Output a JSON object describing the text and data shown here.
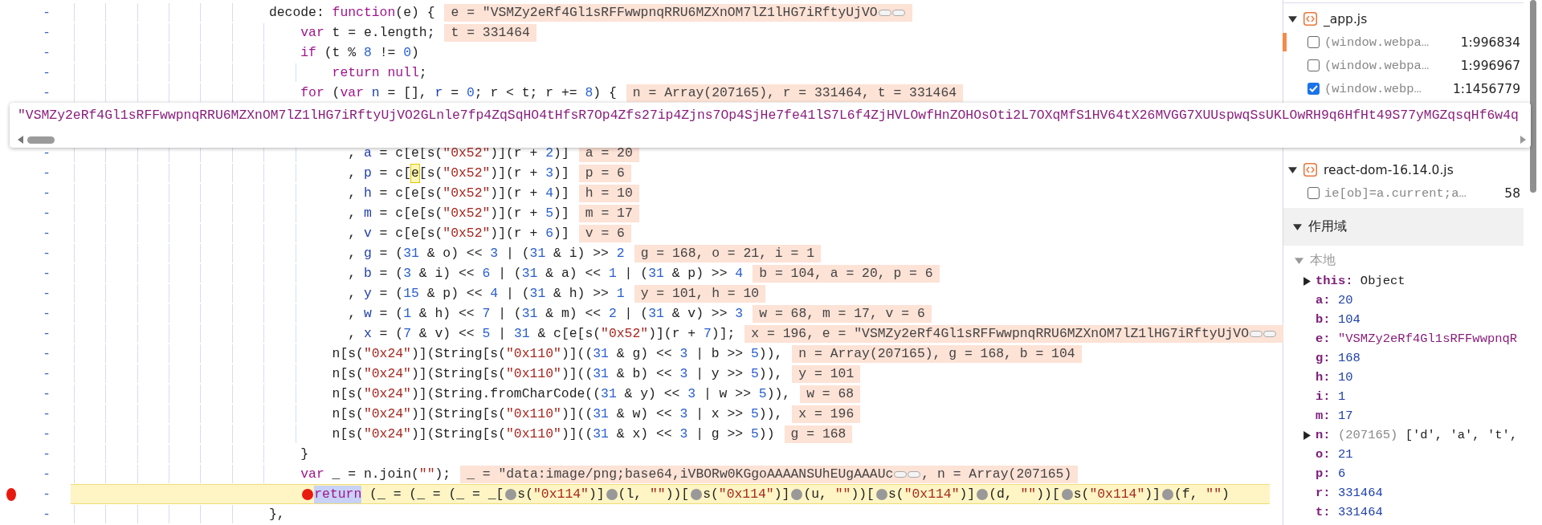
{
  "code_lines": [
    {
      "kind": "code",
      "number": "-",
      "breakpoint": false,
      "paused": false,
      "tokens": [
        {
          "kind": "txt",
          "text": "                         decode: "
        },
        {
          "kind": "kw",
          "text": "function"
        },
        {
          "kind": "txt",
          "text": "(e) {"
        }
      ],
      "value": "e = \"VSMZy2eRf4Gl1sRFFwwpnqRRU6MZXnOM7lZ1lHG7iRftyUjVO",
      "truncated": true
    },
    {
      "kind": "code",
      "number": "-",
      "breakpoint": false,
      "paused": false,
      "tokens": [
        {
          "kind": "kw",
          "text": "                             var"
        },
        {
          "kind": "txt",
          "text": " t = e.length;"
        }
      ],
      "value": "t = 331464",
      "truncated": false
    },
    {
      "kind": "code",
      "number": "-",
      "breakpoint": false,
      "paused": false,
      "tokens": [
        {
          "kind": "kw",
          "text": "                             if"
        },
        {
          "kind": "txt",
          "text": " (t % "
        },
        {
          "kind": "num",
          "text": "8"
        },
        {
          "kind": "txt",
          "text": " != "
        },
        {
          "kind": "num",
          "text": "0"
        },
        {
          "kind": "txt",
          "text": ")"
        }
      ]
    },
    {
      "kind": "code",
      "number": "-",
      "breakpoint": false,
      "paused": false,
      "tokens": [
        {
          "kind": "kw",
          "text": "                                 return null"
        },
        {
          "kind": "txt",
          "text": ";"
        }
      ]
    },
    {
      "kind": "code",
      "number": "-",
      "breakpoint": false,
      "paused": false,
      "tokens": [
        {
          "kind": "kw",
          "text": "                             for"
        },
        {
          "kind": "txt",
          "text": " ("
        },
        {
          "kind": "kw",
          "text": "var"
        },
        {
          "kind": "def",
          "text": " n"
        },
        {
          "kind": "txt",
          "text": " = [], "
        },
        {
          "kind": "def",
          "text": "r"
        },
        {
          "kind": "txt",
          "text": " = "
        },
        {
          "kind": "num",
          "text": "0"
        },
        {
          "kind": "txt",
          "text": "; r < t; r += "
        },
        {
          "kind": "num",
          "text": "8"
        },
        {
          "kind": "txt",
          "text": ") {"
        }
      ],
      "value": "n = Array(207165), r = 331464, t = 331464",
      "truncated": false
    },
    {
      "kind": "popup",
      "text": "\"VSMZy2eRf4Gl1sRFFwwpnqRRU6MZXnOM7lZ1lHG7iRftyUjVO2GLnle7fp4ZqSqHO4tHfsR7Op4Zfs27ip4Zjns7Op4SjHe7fe41lS7L6f4ZjHVLOwfHnZOHOsOti2L7OXqMfS1HV64tX26MVGG7XUUspwqSsUKLOwRH9q6HfHt49S77yMGZqsqHf6w4q"
    },
    {
      "kind": "code",
      "number": "-",
      "breakpoint": false,
      "paused": false,
      "tokens": [
        {
          "kind": "txt",
          "text": "                                   , "
        },
        {
          "kind": "def",
          "text": "a"
        },
        {
          "kind": "txt",
          "text": " = c[e[s("
        },
        {
          "kind": "str",
          "text": "\"0x52\""
        },
        {
          "kind": "txt",
          "text": ")](r + "
        },
        {
          "kind": "num",
          "text": "2"
        },
        {
          "kind": "txt",
          "text": ")]"
        }
      ],
      "value": "a = 20",
      "truncated": false
    },
    {
      "kind": "code",
      "number": "-",
      "breakpoint": false,
      "paused": false,
      "tokens": [
        {
          "kind": "txt",
          "text": "                                   , "
        },
        {
          "kind": "def",
          "text": "p"
        },
        {
          "kind": "txt",
          "text": " = c["
        },
        {
          "kind": "hover",
          "text": "e"
        },
        {
          "kind": "txt",
          "text": "[s("
        },
        {
          "kind": "str",
          "text": "\"0x52\""
        },
        {
          "kind": "txt",
          "text": ")](r + "
        },
        {
          "kind": "num",
          "text": "3"
        },
        {
          "kind": "txt",
          "text": ")]"
        }
      ],
      "value": "p = 6",
      "truncated": false
    },
    {
      "kind": "code",
      "number": "-",
      "breakpoint": false,
      "paused": false,
      "tokens": [
        {
          "kind": "txt",
          "text": "                                   , "
        },
        {
          "kind": "def",
          "text": "h"
        },
        {
          "kind": "txt",
          "text": " = c[e[s("
        },
        {
          "kind": "str",
          "text": "\"0x52\""
        },
        {
          "kind": "txt",
          "text": ")](r + "
        },
        {
          "kind": "num",
          "text": "4"
        },
        {
          "kind": "txt",
          "text": ")]"
        }
      ],
      "value": "h = 10",
      "truncated": false
    },
    {
      "kind": "code",
      "number": "-",
      "breakpoint": false,
      "paused": false,
      "tokens": [
        {
          "kind": "txt",
          "text": "                                   , "
        },
        {
          "kind": "def",
          "text": "m"
        },
        {
          "kind": "txt",
          "text": " = c[e[s("
        },
        {
          "kind": "str",
          "text": "\"0x52\""
        },
        {
          "kind": "txt",
          "text": ")](r + "
        },
        {
          "kind": "num",
          "text": "5"
        },
        {
          "kind": "txt",
          "text": ")]"
        }
      ],
      "value": "m = 17",
      "truncated": false
    },
    {
      "kind": "code",
      "number": "-",
      "breakpoint": false,
      "paused": false,
      "tokens": [
        {
          "kind": "txt",
          "text": "                                   , "
        },
        {
          "kind": "def",
          "text": "v"
        },
        {
          "kind": "txt",
          "text": " = c[e[s("
        },
        {
          "kind": "str",
          "text": "\"0x52\""
        },
        {
          "kind": "txt",
          "text": ")](r + "
        },
        {
          "kind": "num",
          "text": "6"
        },
        {
          "kind": "txt",
          "text": ")]"
        }
      ],
      "value": "v = 6",
      "truncated": false
    },
    {
      "kind": "code",
      "number": "-",
      "breakpoint": false,
      "paused": false,
      "tokens": [
        {
          "kind": "txt",
          "text": "                                   , "
        },
        {
          "kind": "def",
          "text": "g"
        },
        {
          "kind": "txt",
          "text": " = ("
        },
        {
          "kind": "num",
          "text": "31"
        },
        {
          "kind": "txt",
          "text": " & o) << "
        },
        {
          "kind": "num",
          "text": "3"
        },
        {
          "kind": "txt",
          "text": " | ("
        },
        {
          "kind": "num",
          "text": "31"
        },
        {
          "kind": "txt",
          "text": " & i) >> "
        },
        {
          "kind": "num",
          "text": "2"
        }
      ],
      "value": "g = 168, o = 21, i = 1",
      "truncated": false
    },
    {
      "kind": "code",
      "number": "-",
      "breakpoint": false,
      "paused": false,
      "tokens": [
        {
          "kind": "txt",
          "text": "                                   , "
        },
        {
          "kind": "def",
          "text": "b"
        },
        {
          "kind": "txt",
          "text": " = ("
        },
        {
          "kind": "num",
          "text": "3"
        },
        {
          "kind": "txt",
          "text": " & i) << "
        },
        {
          "kind": "num",
          "text": "6"
        },
        {
          "kind": "txt",
          "text": " | ("
        },
        {
          "kind": "num",
          "text": "31"
        },
        {
          "kind": "txt",
          "text": " & a) << "
        },
        {
          "kind": "num",
          "text": "1"
        },
        {
          "kind": "txt",
          "text": " | ("
        },
        {
          "kind": "num",
          "text": "31"
        },
        {
          "kind": "txt",
          "text": " & p) >> "
        },
        {
          "kind": "num",
          "text": "4"
        }
      ],
      "value": "b = 104, a = 20, p = 6",
      "truncated": false
    },
    {
      "kind": "code",
      "number": "-",
      "breakpoint": false,
      "paused": false,
      "tokens": [
        {
          "kind": "txt",
          "text": "                                   , "
        },
        {
          "kind": "def",
          "text": "y"
        },
        {
          "kind": "txt",
          "text": " = ("
        },
        {
          "kind": "num",
          "text": "15"
        },
        {
          "kind": "txt",
          "text": " & p) << "
        },
        {
          "kind": "num",
          "text": "4"
        },
        {
          "kind": "txt",
          "text": " | ("
        },
        {
          "kind": "num",
          "text": "31"
        },
        {
          "kind": "txt",
          "text": " & h) >> "
        },
        {
          "kind": "num",
          "text": "1"
        }
      ],
      "value": "y = 101, h = 10",
      "truncated": false
    },
    {
      "kind": "code",
      "number": "-",
      "breakpoint": false,
      "paused": false,
      "tokens": [
        {
          "kind": "txt",
          "text": "                                   , "
        },
        {
          "kind": "def",
          "text": "w"
        },
        {
          "kind": "txt",
          "text": " = ("
        },
        {
          "kind": "num",
          "text": "1"
        },
        {
          "kind": "txt",
          "text": " & h) << "
        },
        {
          "kind": "num",
          "text": "7"
        },
        {
          "kind": "txt",
          "text": " | ("
        },
        {
          "kind": "num",
          "text": "31"
        },
        {
          "kind": "txt",
          "text": " & m) << "
        },
        {
          "kind": "num",
          "text": "2"
        },
        {
          "kind": "txt",
          "text": " | ("
        },
        {
          "kind": "num",
          "text": "31"
        },
        {
          "kind": "txt",
          "text": " & v) >> "
        },
        {
          "kind": "num",
          "text": "3"
        }
      ],
      "value": "w = 68, m = 17, v = 6",
      "truncated": false
    },
    {
      "kind": "code",
      "number": "-",
      "breakpoint": false,
      "paused": false,
      "tokens": [
        {
          "kind": "txt",
          "text": "                                   , "
        },
        {
          "kind": "def",
          "text": "x"
        },
        {
          "kind": "txt",
          "text": " = ("
        },
        {
          "kind": "num",
          "text": "7"
        },
        {
          "kind": "txt",
          "text": " & v) << "
        },
        {
          "kind": "num",
          "text": "5"
        },
        {
          "kind": "txt",
          "text": " | "
        },
        {
          "kind": "num",
          "text": "31"
        },
        {
          "kind": "txt",
          "text": " & c[e[s("
        },
        {
          "kind": "str",
          "text": "\"0x52\""
        },
        {
          "kind": "txt",
          "text": ")](r + "
        },
        {
          "kind": "num",
          "text": "7"
        },
        {
          "kind": "txt",
          "text": ")];"
        }
      ],
      "value": "x = 196, e = \"VSMZy2eRf4Gl1sRFFwwpnqRRU6MZXnOM7lZ1lHG7iRftyUjVO",
      "truncated": true
    },
    {
      "kind": "code",
      "number": "-",
      "breakpoint": false,
      "paused": false,
      "tokens": [
        {
          "kind": "txt",
          "text": "                                 n[s("
        },
        {
          "kind": "str",
          "text": "\"0x24\""
        },
        {
          "kind": "txt",
          "text": ")](String[s("
        },
        {
          "kind": "str",
          "text": "\"0x110\""
        },
        {
          "kind": "txt",
          "text": ")](("
        },
        {
          "kind": "num",
          "text": "31"
        },
        {
          "kind": "txt",
          "text": " & g) << "
        },
        {
          "kind": "num",
          "text": "3"
        },
        {
          "kind": "txt",
          "text": " | b >> "
        },
        {
          "kind": "num",
          "text": "5"
        },
        {
          "kind": "txt",
          "text": ")),"
        }
      ],
      "value": "n = Array(207165), g = 168, b = 104",
      "truncated": false
    },
    {
      "kind": "code",
      "number": "-",
      "breakpoint": false,
      "paused": false,
      "tokens": [
        {
          "kind": "txt",
          "text": "                                 n[s("
        },
        {
          "kind": "str",
          "text": "\"0x24\""
        },
        {
          "kind": "txt",
          "text": ")](String[s("
        },
        {
          "kind": "str",
          "text": "\"0x110\""
        },
        {
          "kind": "txt",
          "text": ")](("
        },
        {
          "kind": "num",
          "text": "31"
        },
        {
          "kind": "txt",
          "text": " & b) << "
        },
        {
          "kind": "num",
          "text": "3"
        },
        {
          "kind": "txt",
          "text": " | y >> "
        },
        {
          "kind": "num",
          "text": "5"
        },
        {
          "kind": "txt",
          "text": ")),"
        }
      ],
      "value": "y = 101",
      "truncated": false
    },
    {
      "kind": "code",
      "number": "-",
      "breakpoint": false,
      "paused": false,
      "tokens": [
        {
          "kind": "txt",
          "text": "                                 n[s("
        },
        {
          "kind": "str",
          "text": "\"0x24\""
        },
        {
          "kind": "txt",
          "text": ")](String.fromCharCode(("
        },
        {
          "kind": "num",
          "text": "31"
        },
        {
          "kind": "txt",
          "text": " & y) << "
        },
        {
          "kind": "num",
          "text": "3"
        },
        {
          "kind": "txt",
          "text": " | w >> "
        },
        {
          "kind": "num",
          "text": "5"
        },
        {
          "kind": "txt",
          "text": ")),"
        }
      ],
      "value": "w = 68",
      "truncated": false
    },
    {
      "kind": "code",
      "number": "-",
      "breakpoint": false,
      "paused": false,
      "tokens": [
        {
          "kind": "txt",
          "text": "                                 n[s("
        },
        {
          "kind": "str",
          "text": "\"0x24\""
        },
        {
          "kind": "txt",
          "text": ")](String[s("
        },
        {
          "kind": "str",
          "text": "\"0x110\""
        },
        {
          "kind": "txt",
          "text": ")](("
        },
        {
          "kind": "num",
          "text": "31"
        },
        {
          "kind": "txt",
          "text": " & w) << "
        },
        {
          "kind": "num",
          "text": "3"
        },
        {
          "kind": "txt",
          "text": " | x >> "
        },
        {
          "kind": "num",
          "text": "5"
        },
        {
          "kind": "txt",
          "text": ")),"
        }
      ],
      "value": "x = 196",
      "truncated": false
    },
    {
      "kind": "code",
      "number": "-",
      "breakpoint": false,
      "paused": false,
      "tokens": [
        {
          "kind": "txt",
          "text": "                                 n[s("
        },
        {
          "kind": "str",
          "text": "\"0x24\""
        },
        {
          "kind": "txt",
          "text": ")](String[s("
        },
        {
          "kind": "str",
          "text": "\"0x110\""
        },
        {
          "kind": "txt",
          "text": ")](("
        },
        {
          "kind": "num",
          "text": "31"
        },
        {
          "kind": "txt",
          "text": " & x) << "
        },
        {
          "kind": "num",
          "text": "3"
        },
        {
          "kind": "txt",
          "text": " | g >> "
        },
        {
          "kind": "num",
          "text": "5"
        },
        {
          "kind": "txt",
          "text": "))"
        }
      ],
      "value": "g = 168",
      "truncated": false
    },
    {
      "kind": "code",
      "number": "-",
      "breakpoint": false,
      "paused": false,
      "tokens": [
        {
          "kind": "txt",
          "text": "                             }"
        }
      ]
    },
    {
      "kind": "code",
      "number": "-",
      "breakpoint": false,
      "paused": false,
      "tokens": [
        {
          "kind": "kw",
          "text": "                             var"
        },
        {
          "kind": "txt",
          "text": " _ = n.join("
        },
        {
          "kind": "str",
          "text": "\"\""
        },
        {
          "kind": "txt",
          "text": ");"
        }
      ],
      "value": "_ = \"data:image/png;base64,iVBORw0KGgoAAAANSUhEUgAAAUc",
      "truncated": true,
      "value_after": ", n = Array(207165)"
    },
    {
      "kind": "code",
      "number": "-",
      "breakpoint": true,
      "paused": true,
      "tokens": [
        {
          "kind": "bp",
          "active": true
        },
        {
          "kind": "sel",
          "text": "                             return"
        },
        {
          "kind": "txt",
          "text": " (_ = (_ = (_ = _["
        },
        {
          "kind": "bp",
          "active": false
        },
        {
          "kind": "txt",
          "text": "s("
        },
        {
          "kind": "str",
          "text": "\"0x114\""
        },
        {
          "kind": "txt",
          "text": ")]"
        },
        {
          "kind": "bp",
          "active": false
        },
        {
          "kind": "txt",
          "text": "(l, "
        },
        {
          "kind": "str",
          "text": "\"\""
        },
        {
          "kind": "txt",
          "text": "))["
        },
        {
          "kind": "bp",
          "active": false
        },
        {
          "kind": "txt",
          "text": "s("
        },
        {
          "kind": "str",
          "text": "\"0x114\""
        },
        {
          "kind": "txt",
          "text": ")]"
        },
        {
          "kind": "bp",
          "active": false
        },
        {
          "kind": "txt",
          "text": "(u, "
        },
        {
          "kind": "str",
          "text": "\"\""
        },
        {
          "kind": "txt",
          "text": "))["
        },
        {
          "kind": "bp",
          "active": false
        },
        {
          "kind": "txt",
          "text": "s("
        },
        {
          "kind": "str",
          "text": "\"0x114\""
        },
        {
          "kind": "txt",
          "text": ")]"
        },
        {
          "kind": "bp",
          "active": false
        },
        {
          "kind": "txt",
          "text": "(d, "
        },
        {
          "kind": "str",
          "text": "\"\""
        },
        {
          "kind": "txt",
          "text": "))["
        },
        {
          "kind": "bp",
          "active": false
        },
        {
          "kind": "txt",
          "text": "s("
        },
        {
          "kind": "str",
          "text": "\"0x114\""
        },
        {
          "kind": "txt",
          "text": ")]"
        },
        {
          "kind": "bp",
          "active": false
        },
        {
          "kind": "txt",
          "text": "(f, "
        },
        {
          "kind": "str",
          "text": "\"\""
        },
        {
          "kind": "txt",
          "text": ")"
        }
      ]
    },
    {
      "kind": "code",
      "number": "-",
      "breakpoint": false,
      "paused": false,
      "tokens": [
        {
          "kind": "txt",
          "text": "                         },"
        }
      ]
    }
  ],
  "breakpoints": {
    "files": [
      {
        "name": "_app.js",
        "expanded": true,
        "items": [
          {
            "code": "(window.webpa…",
            "location": "1:996834",
            "checked": false,
            "current": true
          },
          {
            "code": "(window.webpa…",
            "location": "1:996967",
            "checked": false,
            "current": false
          },
          {
            "code": "(window.webp…",
            "location": "1:1456779",
            "checked": true,
            "current": false
          }
        ]
      },
      {
        "name": "react-dom-16.14.0.js",
        "expanded": true,
        "items": [
          {
            "code": "ie[ob]=a.current;a…",
            "location": "58",
            "checked": false,
            "current": false
          }
        ]
      }
    ]
  },
  "scope": {
    "title": "作用域",
    "expanded": true,
    "groups": [
      {
        "title": "本地",
        "expanded": true,
        "entries": [
          {
            "name": "this:",
            "value": "Object",
            "kind": "object",
            "expandable": true
          },
          {
            "name": "a:",
            "value": "20",
            "kind": "number",
            "expandable": false
          },
          {
            "name": "b:",
            "value": "104",
            "kind": "number",
            "expandable": false
          },
          {
            "name": "e:",
            "value": "\"VSMZy2eRf4Gl1sRFFwwpnqR",
            "kind": "string",
            "expandable": false
          },
          {
            "name": "g:",
            "value": "168",
            "kind": "number",
            "expandable": false
          },
          {
            "name": "h:",
            "value": "10",
            "kind": "number",
            "expandable": false
          },
          {
            "name": "i:",
            "value": "1",
            "kind": "number",
            "expandable": false
          },
          {
            "name": "m:",
            "value": "17",
            "kind": "number",
            "expandable": false
          },
          {
            "name": "n:",
            "count": "(207165)",
            "value": "['d', 'a', 't',",
            "kind": "array",
            "expandable": true
          },
          {
            "name": "o:",
            "value": "21",
            "kind": "number",
            "expandable": false
          },
          {
            "name": "p:",
            "value": "6",
            "kind": "number",
            "expandable": false
          },
          {
            "name": "r:",
            "value": "331464",
            "kind": "number",
            "expandable": false
          },
          {
            "name": "t:",
            "value": "331464",
            "kind": "number",
            "expandable": false
          }
        ]
      }
    ]
  }
}
